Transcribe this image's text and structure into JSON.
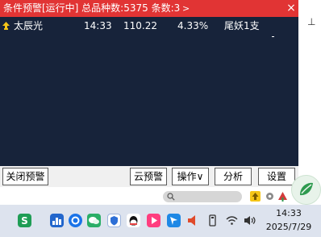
{
  "window": {
    "title": "条件预警[运行中] 总品种数:5375 条数:3",
    "title_arrow": ">",
    "close_symbol": "×",
    "header_color": "#e13434",
    "panel_color": "#17233a"
  },
  "alerts": [
    {
      "name": "太辰光",
      "time": "14:33",
      "price": "110.22",
      "change_pct": "4.33%",
      "condition": "尾妖1支",
      "icon": "rising-arrow-icon"
    }
  ],
  "buttons": {
    "close_alert": "关闭预警",
    "cloud_alert": "云预警",
    "operate": "操作∨",
    "analyze": "分析",
    "settings": "设置"
  },
  "right_strip": {
    "char": "⊥"
  },
  "taskbar": {
    "time": "14:33",
    "date": "2025/7/29",
    "icons": [
      "app-s-icon",
      "chart-app-icon",
      "browser-icon",
      "wechat-icon",
      "shield-icon",
      "qq-icon",
      "video-app-icon",
      "feishu-icon",
      "speaker-icon",
      "usb-icon",
      "wifi-icon",
      "volume-icon"
    ]
  }
}
